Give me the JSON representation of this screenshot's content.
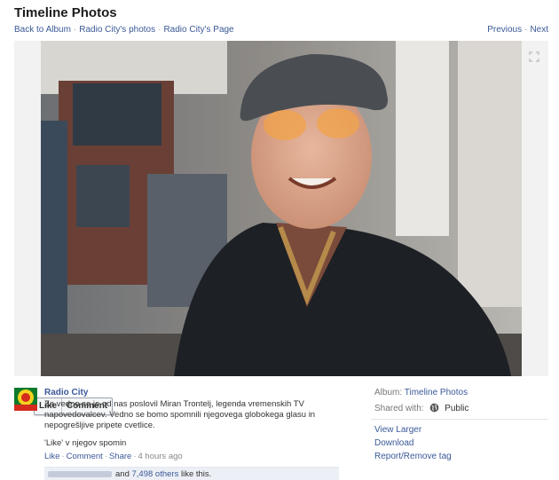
{
  "header": {
    "title": "Timeline Photos",
    "breadcrumbs": [
      "Back to Album",
      "Radio City's photos",
      "Radio City's Page"
    ],
    "pager": {
      "previous": "Previous",
      "next": "Next"
    }
  },
  "photo": {
    "like_label": "Like",
    "comment_label": "Comment"
  },
  "post": {
    "author": "Radio City",
    "message": "Za vedno se je od nas poslovil Miran Trontelj, legenda vremenskih TV napovedovalcev. Vedno se bomo spomnili njegovega globokega glasu in nepogrešljive pripete cvetlice.",
    "message2": "'Like' v njegov spomin",
    "actions": {
      "like": "Like",
      "comment": "Comment",
      "share": "Share",
      "time": "4 hours ago"
    },
    "likes": {
      "prefix": "and",
      "others": "7,498 others",
      "suffix": "like this."
    }
  },
  "sidebar": {
    "album_label": "Album:",
    "album_value": "Timeline Photos",
    "shared_label": "Shared with:",
    "shared_value": "Public",
    "links": [
      "View Larger",
      "Download",
      "Report/Remove tag"
    ]
  },
  "colors": {
    "link": "#3b5998",
    "stage": "#f2f2f2"
  }
}
